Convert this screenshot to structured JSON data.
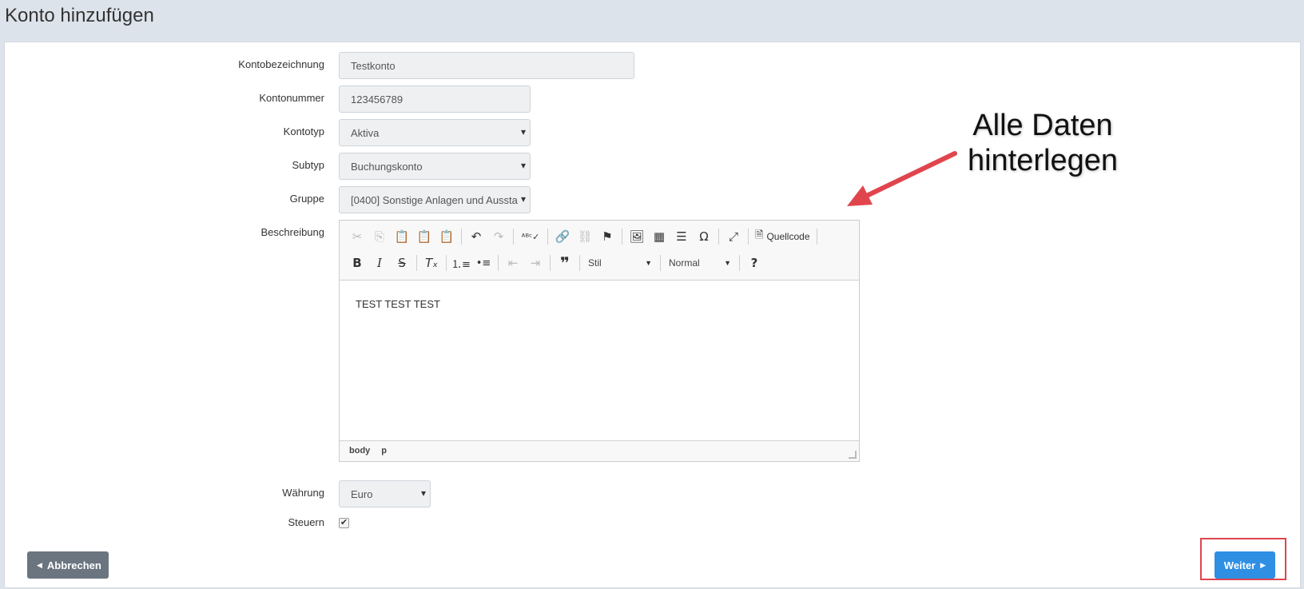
{
  "page": {
    "title": "Konto hinzufügen"
  },
  "form": {
    "kontobezeichnung": {
      "label": "Kontobezeichnung",
      "value": "Testkonto"
    },
    "kontonummer": {
      "label": "Kontonummer",
      "value": "123456789"
    },
    "kontotyp": {
      "label": "Kontotyp",
      "value": "Aktiva"
    },
    "subtyp": {
      "label": "Subtyp",
      "value": "Buchungskonto"
    },
    "gruppe": {
      "label": "Gruppe",
      "value": "[0400] Sonstige Anlagen und Aussta"
    },
    "beschreibung": {
      "label": "Beschreibung",
      "content": "TEST TEST TEST",
      "toolbar": {
        "source_label": "Quellcode",
        "style_combo": "Stil",
        "format_combo": "Normal"
      },
      "statusbar": [
        "body",
        "p"
      ]
    },
    "waehrung": {
      "label": "Währung",
      "value": "Euro"
    },
    "steuern": {
      "label": "Steuern",
      "checked": true
    }
  },
  "buttons": {
    "cancel": "Abbrechen",
    "next": "Weiter"
  },
  "annotation": {
    "line1": "Alle Daten",
    "line2": "hinterlegen"
  },
  "colors": {
    "primary": "#2f8fe3",
    "cancel": "#6b7580",
    "highlight": "#e0454d"
  }
}
